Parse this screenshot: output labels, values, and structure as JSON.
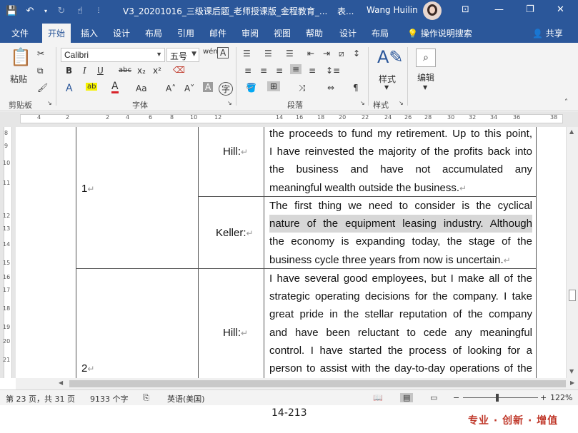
{
  "titlebar": {
    "doc_title": "V3_20201016_三级课后题_老师授课版_金程教育_...",
    "doc_suffix": "表...",
    "user": "Wang Huilin",
    "icons": [
      "save-icon",
      "undo-icon",
      "redo-icon",
      "touch-mode-icon",
      "customize-icon"
    ]
  },
  "tabs": {
    "items": [
      "文件",
      "开始",
      "插入",
      "设计",
      "布局",
      "引用",
      "邮件",
      "审阅",
      "视图",
      "帮助",
      "设计",
      "布局"
    ],
    "active": "开始",
    "tell_me": "操作说明搜索",
    "share": "共享"
  },
  "ribbon": {
    "paste": "粘贴",
    "font_name": "Calibri",
    "font_size": "五号",
    "style_label": "样式",
    "edit_label": "编辑",
    "groups": {
      "clipboard": "剪贴板",
      "font": "字体",
      "paragraph": "段落",
      "styles": "样式"
    }
  },
  "ruler": {
    "ticks": [
      "4",
      "2",
      "2",
      "4",
      "6",
      "8",
      "10",
      "12",
      "14",
      "16",
      "18",
      "20",
      "22",
      "24",
      "26",
      "28",
      "30",
      "32",
      "34",
      "36",
      "38"
    ]
  },
  "vruler": {
    "ticks": [
      "8",
      "9",
      "10",
      "11",
      "12",
      "13",
      "14",
      "15",
      "16",
      "17",
      "18",
      "19",
      "20",
      "21"
    ]
  },
  "document": {
    "rows": [
      {
        "number": "1",
        "entries": [
          {
            "speaker": "Hill:",
            "lines": [
              "the proceeds to fund my retirement. Up to this point,",
              "I have reinvested the majority of the profits back into",
              "the business and have not accumulated any",
              "meaningful wealth outside the business."
            ]
          },
          {
            "speaker": "Keller:",
            "lines": [
              "The first thing we need to consider is the cyclical",
              "nature of the equipment leasing industry. Although",
              "the economy is expanding today, the stage of the",
              "business cycle three years from now is uncertain."
            ]
          }
        ]
      },
      {
        "number": "2",
        "entries": [
          {
            "speaker": "Hill:",
            "lines": [
              "I have several good employees, but I make all of the",
              "strategic operating decisions for the company. I take",
              "great pride in the stellar reputation of the company",
              "and have been reluctant to cede any meaningful",
              "control. I have started the process of looking for a",
              "person to assist with the day-to-day operations of the"
            ]
          }
        ]
      }
    ]
  },
  "status": {
    "page": "第 23 页，共 31 页",
    "words": "9133 个字",
    "language": "英语(美国)",
    "zoom": "122%"
  },
  "footer": {
    "page_number": "14-213",
    "slogan": "专业 · 创新 · 增值"
  }
}
